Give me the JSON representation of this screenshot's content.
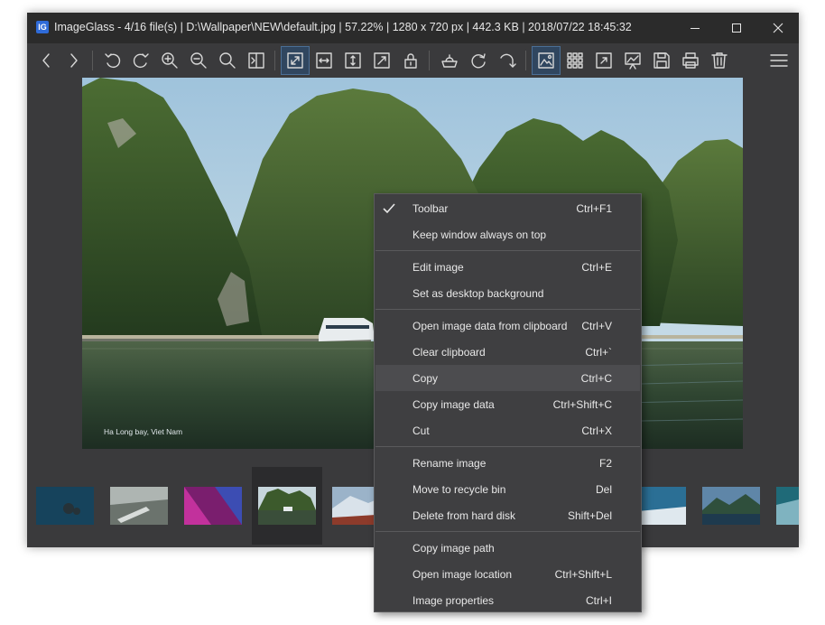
{
  "window": {
    "title": "ImageGlass - 4/16 file(s)  |  D:\\Wallpaper\\NEW\\default.jpg  |  57.22%  |  1280 x 720 px  |  442.3 KB  |  2018/07/22 18:45:32",
    "app_icon_glyph": "IG",
    "controls": [
      "minimize-icon",
      "maximize-icon",
      "close-icon"
    ]
  },
  "toolbar": {
    "buttons": [
      {
        "icon": "arrow-left-icon"
      },
      {
        "icon": "arrow-right-icon"
      },
      {
        "icon": "rotate-left-icon"
      },
      {
        "icon": "rotate-right-icon"
      },
      {
        "icon": "zoom-in-icon"
      },
      {
        "icon": "zoom-out-icon"
      },
      {
        "icon": "actual-size-icon"
      },
      {
        "icon": "scale-to-fit-icon"
      },
      {
        "icon": "auto-zoom-icon",
        "active": true
      },
      {
        "icon": "scale-width-icon"
      },
      {
        "icon": "scale-height-icon"
      },
      {
        "icon": "scale-to-fill-icon"
      },
      {
        "icon": "lock-zoom-icon"
      },
      {
        "icon": "checkerboard-icon"
      },
      {
        "icon": "refresh-icon"
      },
      {
        "icon": "goto-icon"
      },
      {
        "icon": "gallery-icon",
        "active": true
      },
      {
        "icon": "thumbnail-grid-icon"
      },
      {
        "icon": "fullscreen-icon"
      },
      {
        "icon": "slideshow-icon"
      },
      {
        "icon": "save-icon"
      },
      {
        "icon": "print-icon"
      },
      {
        "icon": "delete-icon"
      },
      {
        "icon": "menu-icon"
      }
    ]
  },
  "viewer": {
    "caption": "Ha Long bay, Viet Nam"
  },
  "thumbnails": {
    "count": 11,
    "selected_index": 3
  },
  "context_menu": {
    "groups": [
      [
        {
          "label": "Toolbar",
          "shortcut": "Ctrl+F1",
          "checked": true
        },
        {
          "label": "Keep window always on top",
          "shortcut": ""
        }
      ],
      [
        {
          "label": "Edit image",
          "shortcut": "Ctrl+E"
        },
        {
          "label": "Set as desktop background",
          "shortcut": ""
        }
      ],
      [
        {
          "label": "Open image data from clipboard",
          "shortcut": "Ctrl+V"
        },
        {
          "label": "Clear clipboard",
          "shortcut": "Ctrl+`"
        },
        {
          "label": "Copy",
          "shortcut": "Ctrl+C",
          "highlighted": true
        },
        {
          "label": "Copy image data",
          "shortcut": "Ctrl+Shift+C"
        },
        {
          "label": "Cut",
          "shortcut": "Ctrl+X"
        }
      ],
      [
        {
          "label": "Rename image",
          "shortcut": "F2"
        },
        {
          "label": "Move to recycle bin",
          "shortcut": "Del"
        },
        {
          "label": "Delete from hard disk",
          "shortcut": "Shift+Del"
        }
      ],
      [
        {
          "label": "Copy image path",
          "shortcut": ""
        },
        {
          "label": "Open image location",
          "shortcut": "Ctrl+Shift+L"
        },
        {
          "label": "Image properties",
          "shortcut": "Ctrl+I"
        }
      ]
    ]
  },
  "colors": {
    "window_bg": "#3a3a3c",
    "titlebar_bg": "#2b2b2b",
    "active_button_bg": "#30465f",
    "menu_bg": "#3f3f41",
    "menu_highlight": "#4c4c4f"
  }
}
